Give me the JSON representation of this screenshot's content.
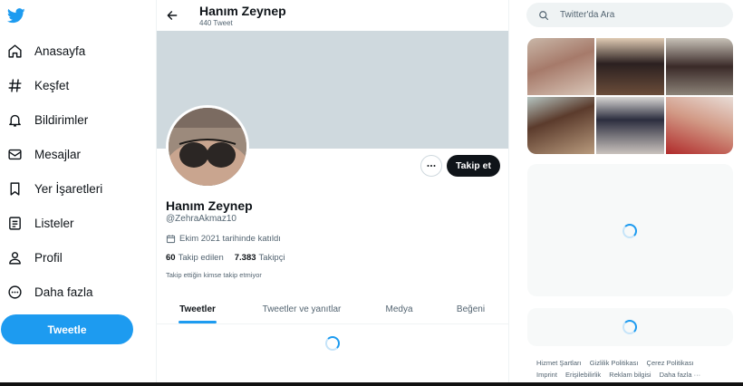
{
  "sidebar": {
    "logo_icon": "twitter-bird-icon",
    "items": [
      {
        "label": "Anasayfa",
        "icon": "home-icon"
      },
      {
        "label": "Keşfet",
        "icon": "hashtag-icon"
      },
      {
        "label": "Bildirimler",
        "icon": "bell-icon"
      },
      {
        "label": "Mesajlar",
        "icon": "envelope-icon"
      },
      {
        "label": "Yer İşaretleri",
        "icon": "bookmark-icon"
      },
      {
        "label": "Listeler",
        "icon": "list-icon"
      },
      {
        "label": "Profil",
        "icon": "person-icon"
      },
      {
        "label": "Daha fazla",
        "icon": "more-circle-icon"
      }
    ],
    "tweet_button": "Tweetle"
  },
  "header": {
    "name": "Hanım Zeynep",
    "tweet_count": "440 Tweet"
  },
  "profile": {
    "name": "Hanım Zeynep",
    "handle": "@ZehraAkmaz10",
    "joined": "Ekim 2021 tarihinde katıldı",
    "following_count": "60",
    "following_label": "Takip edilen",
    "followers_count": "7.383",
    "followers_label": "Takipçi",
    "followed_by_note": "Takip ettiğin kimse takip etmiyor",
    "follow_button": "Takip et"
  },
  "tabs": [
    "Tweetler",
    "Tweetler ve yanıtlar",
    "Medya",
    "Beğeni"
  ],
  "active_tab": 0,
  "search": {
    "placeholder": "Twitter'da Ara"
  },
  "footer_links": [
    "Hizmet Şartları",
    "Gizlilik Politikası",
    "Çerez Politikası",
    "Imprint",
    "Erişilebilirlik",
    "Reklam bilgisi",
    "Daha fazla ···"
  ],
  "colors": {
    "accent": "#1d9bf0",
    "banner": "#cfd9de",
    "text": "#0f1419",
    "muted": "#536471"
  }
}
